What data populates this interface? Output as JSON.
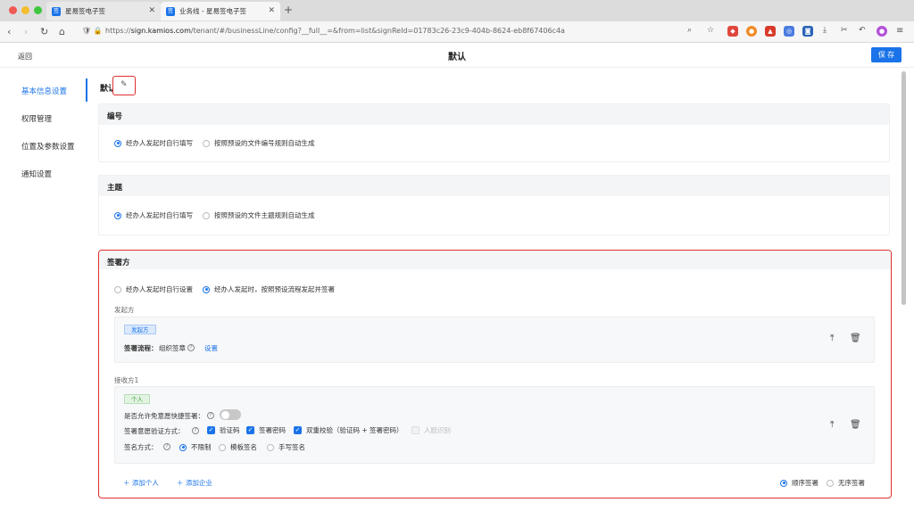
{
  "browser": {
    "tabs": [
      {
        "favicon": "签",
        "title": "星易签电子签"
      },
      {
        "favicon": "签",
        "title": "业务线 - 星易签电子签"
      }
    ],
    "url_prefix": "https://",
    "url_host": "sign.kamios.com",
    "url_path": "/tenant/#/businessLine/config?__full__=&from=list&signReId=01783c26-23c9-404b-8624-eb8f67406c4a"
  },
  "header": {
    "back_label": "返回",
    "title": "默认",
    "save_label": "保 存"
  },
  "sidebar": {
    "items": [
      {
        "label": "基本信息设置",
        "active": true
      },
      {
        "label": "权限管理"
      },
      {
        "label": "位置及参数设置"
      },
      {
        "label": "通知设置"
      }
    ]
  },
  "main": {
    "title": "默认",
    "numbering": {
      "heading": "编号",
      "options": [
        "经办人发起时自行填写",
        "按照预设的文件编号规则自动生成"
      ],
      "selected": 0
    },
    "subject": {
      "heading": "主题",
      "options": [
        "经办人发起时自行填写",
        "按照预设的文件主题规则自动生成"
      ],
      "selected": 0
    },
    "signers": {
      "heading": "签署方",
      "options": [
        "经办人发起时自行设置",
        "经办人发起时，按照预设流程发起并签署"
      ],
      "selected": 1,
      "initiator": {
        "label": "发起方",
        "tag": "发起方",
        "flow_label": "签署流程：",
        "flow_value": "组织签章",
        "settings_link": "设置"
      },
      "receiver": {
        "label": "接收方1",
        "tag": "个人",
        "quick_sign_label": "是否允许免意愿快捷签署：",
        "verify_label": "签署意愿验证方式：",
        "verify_options": [
          {
            "label": "验证码",
            "checked": true
          },
          {
            "label": "签署密码",
            "checked": true
          },
          {
            "label": "双重校验（验证码 + 签署密码）",
            "checked": true
          },
          {
            "label": "人脸识别",
            "checked": false,
            "disabled": true
          }
        ],
        "sign_method_label": "签名方式：",
        "sign_methods": [
          "不限制",
          "模板签名",
          "手写签名"
        ],
        "sign_method_selected": 0
      },
      "add_person": "添加个人",
      "add_company": "添加企业",
      "order_options": [
        "顺序签署",
        "无序签署"
      ],
      "order_selected": 0
    }
  },
  "colors": {
    "accent": "#1a73e8",
    "highlight_border": "#e02e2e"
  }
}
